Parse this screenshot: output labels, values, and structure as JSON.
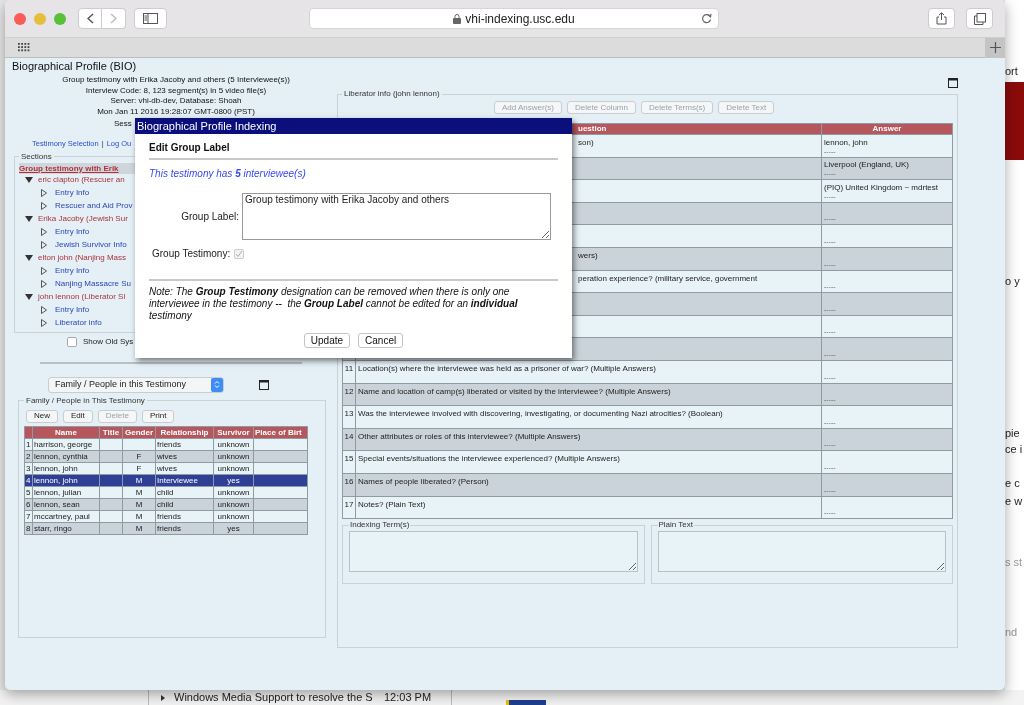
{
  "browser": {
    "url": "vhi-indexing.usc.edu"
  },
  "page": {
    "title": "Biographical Profile (BIO)",
    "header_lines": [
      "Group testimony with Erika Jacoby and others (5 Interviewee(s))",
      "Interview Code: 8, 123 segment(s) in 5 video file(s)",
      "Server: vhi-db-dev, Database: Shoah",
      "Mon Jan 11 2016 19:28:07 GMT-0800 (PST)",
      "Sess"
    ],
    "links": [
      "Testimony Selection",
      "Log Ou"
    ],
    "link_separator": "|",
    "sections": {
      "legend": "Sections",
      "root": "Group testimony with Erik",
      "children": [
        {
          "label": "eric clapton (Rescuer an",
          "expanded": true,
          "children": [
            {
              "label": "Entry Info",
              "expanded": false
            },
            {
              "label": "Rescuer and Aid Prov",
              "expanded": false
            }
          ]
        },
        {
          "label": "Erika Jacoby (Jewish Sur",
          "expanded": true,
          "children": [
            {
              "label": "Entry Info",
              "expanded": false
            },
            {
              "label": "Jewish Survivor Info",
              "expanded": false
            }
          ]
        },
        {
          "label": "elton john (Nanjing Mass",
          "expanded": true,
          "children": [
            {
              "label": "Entry Info",
              "expanded": false
            },
            {
              "label": "Nanjing Massacre Su",
              "expanded": false
            }
          ]
        },
        {
          "label": "john lennon (Liberator Sl",
          "expanded": true,
          "children": [
            {
              "label": "Entry Info",
              "expanded": false
            },
            {
              "label": "Liberator info",
              "expanded": false
            }
          ]
        }
      ]
    },
    "show_old": {
      "label": "Show Old Sys",
      "checked": false
    },
    "people_select": {
      "value": "Family / People in this Testimony"
    },
    "people": {
      "legend": "Family / People in This Testimony",
      "buttons": [
        {
          "label": "New",
          "disabled": false
        },
        {
          "label": "Edit",
          "disabled": false
        },
        {
          "label": "Delete",
          "disabled": true
        },
        {
          "label": "Print",
          "disabled": false
        }
      ],
      "columns": [
        "Name",
        "Title",
        "Gender",
        "Relationship",
        "Survivor",
        "Place of Birt"
      ],
      "rows": [
        {
          "number": "1",
          "name": "harrison, george",
          "relationship": "friends",
          "survivor": "unknown",
          "selected": false
        },
        {
          "number": "2",
          "name": "lennon, cynthia",
          "gender": "F",
          "relationship": "wives",
          "survivor": "unknown",
          "selected": false
        },
        {
          "number": "3",
          "name": "lennon, john",
          "gender": "F",
          "relationship": "wives",
          "survivor": "unknown",
          "selected": false
        },
        {
          "number": "4",
          "name": "lennon, john",
          "gender": "M",
          "relationship": "Interviewee",
          "survivor": "yes",
          "selected": true
        },
        {
          "number": "5",
          "name": "lennon, julian",
          "gender": "M",
          "relationship": "child",
          "survivor": "unknown",
          "selected": false
        },
        {
          "number": "6",
          "name": "lennon, sean",
          "gender": "M",
          "relationship": "child",
          "survivor": "unknown",
          "selected": false
        },
        {
          "number": "7",
          "name": "mccartney, paul",
          "gender": "M",
          "relationship": "friends",
          "survivor": "unknown",
          "selected": false
        },
        {
          "number": "8",
          "name": "starr, ringo",
          "gender": "M",
          "relationship": "friends",
          "survivor": "yes",
          "selected": false
        }
      ]
    },
    "liberator": {
      "legend": "Liberator info (john lennon)",
      "buttons": [
        {
          "label": "Add Answer(s)",
          "disabled": true
        },
        {
          "label": "Delete Column",
          "disabled": true
        },
        {
          "label": "Delete Terms(s)",
          "disabled": true
        },
        {
          "label": "Delete Text",
          "disabled": true
        }
      ],
      "columns": [
        "uestion",
        "Answer"
      ],
      "rows": [
        {
          "question": "son)",
          "answer": [
            "lennon, john",
            "-----"
          ]
        },
        {
          "answer": [
            "Liverpool (England, UK)",
            "-----"
          ]
        },
        {
          "answer": [
            "(PIQ) United Kingdom ~ mdrtest",
            "-----"
          ]
        },
        {
          "answer": [
            "-----"
          ]
        },
        {
          "answer": [
            "-----"
          ]
        },
        {
          "question": "wers)",
          "answer": [
            "-----"
          ]
        },
        {
          "question": "peration experience? (military service, government",
          "answer": [
            "-----"
          ]
        },
        {
          "answer": [
            "-----"
          ]
        },
        {
          "answer": [
            "-----"
          ]
        },
        {
          "answer": [
            "-----"
          ]
        },
        {
          "number": "11",
          "question": "Location(s) where the interviewee was held as a prisoner of war? (Multiple Answers)",
          "answer": [
            "-----"
          ]
        },
        {
          "number": "12",
          "question": "Name and location of camp(s) liberated or visited by the interviewee? (Multiple Answers)",
          "answer": [
            "-----"
          ]
        },
        {
          "number": "13",
          "question": "Was the interviewee involved with discovering, investigating, or documenting Nazi atrocities? (Boolean)",
          "answer": [
            "-----"
          ]
        },
        {
          "number": "14",
          "question": "Other attributes or roles of this interviewee? (Multiple Answers)",
          "answer": [
            "-----"
          ]
        },
        {
          "number": "15",
          "question": "Special events/situations the interviewee experienced? (Multiple Answers)",
          "answer": [
            "-----"
          ]
        },
        {
          "number": "16",
          "question": "Names of people liberated? (Person)",
          "answer": [
            "-----"
          ]
        },
        {
          "number": "17",
          "question": "Notes? (Plain Text)",
          "answer": [
            "-----"
          ]
        }
      ]
    },
    "indexing_terms": {
      "legend": "Indexing Term(s)"
    },
    "plain_text": {
      "legend": "Plain Text"
    }
  },
  "dialog": {
    "title": "Biographical Profile Indexing",
    "heading": "Edit Group Label",
    "count_text": "This testimony has **5** interviewee(s)",
    "group_label": {
      "label": "Group Label:",
      "value": "Group testimony with Erika Jacoby and others"
    },
    "group_testimony": {
      "label": "Group Testimony:",
      "checked": true,
      "disabled": true
    },
    "note": "Note: The **Group Testimony** designation can be removed when there is only one interviewee in the testimony --  the **Group Label** cannot be edited for an **individual** testimony",
    "buttons": [
      "Update",
      "Cancel"
    ]
  },
  "background": {
    "fragments": [
      "ort",
      "o y",
      "pie",
      "ce i",
      "e c",
      "e w",
      "s st",
      "nd"
    ],
    "taskbar": {
      "item": "Windows Media Support to resolve the S",
      "time": "12:03 PM"
    }
  }
}
